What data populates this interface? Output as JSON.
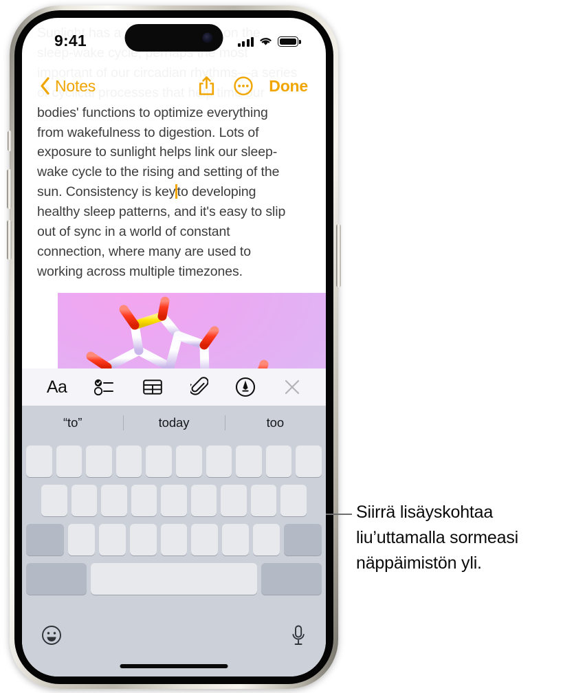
{
  "device": {
    "name": "iphone-15-pro",
    "statusbar": {
      "time": "9:41",
      "cellular_icon": "cellular-signal-icon",
      "wifi_icon": "wifi-icon",
      "battery_icon": "battery-full-icon"
    }
  },
  "navbar": {
    "back_icon": "chevron-left-icon",
    "back_label": "Notes",
    "share_icon": "share-icon",
    "more_icon": "more-circle-icon",
    "done_label": "Done",
    "accent_color": "#f0a500"
  },
  "note": {
    "faded_lines": [
      "Sunlight has a profound impact on the",
      "sleep-wake cycle, perhaps the most",
      "important of our circadian rhythms—a series",
      "of cyclical processes that help time our"
    ],
    "visible_lines": [
      "bodies' functions to optimize everything",
      "from wakefulness to digestion. Lots of",
      "exposure to sunlight helps link our sleep-",
      "wake cycle to the rising and setting of the"
    ],
    "caret_line_before": "sun. Consistency is key",
    "caret_line_after": "to developing",
    "tail_lines": [
      "healthy sleep patterns, and it's easy to slip",
      "out of sync in a world of constant",
      "connection, where many are used to",
      "working across multiple timezones."
    ],
    "attachment": {
      "name": "molecule-image",
      "description": "3D ball-and-stick molecular structure on pink gradient"
    },
    "text_color": "#3c3c3c",
    "caret_color": "#f0a500"
  },
  "format_toolbar": {
    "items": [
      {
        "name": "format-aa-button",
        "label": "Aa",
        "icon": "text-format-icon"
      },
      {
        "name": "checklist-button",
        "label": "",
        "icon": "checklist-icon"
      },
      {
        "name": "table-button",
        "label": "",
        "icon": "table-icon"
      },
      {
        "name": "attachment-button",
        "label": "",
        "icon": "paperclip-icon"
      },
      {
        "name": "markup-button",
        "label": "",
        "icon": "markup-pen-icon"
      },
      {
        "name": "close-keyboard-button",
        "label": "",
        "icon": "close-x-icon"
      }
    ],
    "background": "#f5f4f8"
  },
  "predictive_bar": {
    "suggestions": [
      "“to”",
      "today",
      "too"
    ],
    "background": "#ccd0d9"
  },
  "keyboard": {
    "background": "#ccd0d9",
    "key_color": "#e7e9ed",
    "modifier_color": "#b4bac5",
    "row1_count": 10,
    "row2_count": 9,
    "row3_letter_count": 7,
    "shift_icon": "shift-key",
    "delete_icon": "delete-key",
    "numbers_key": "123-key",
    "space_key": "space-key",
    "return_key": "return-key",
    "emoji_icon": "emoji-smiley-icon",
    "dictation_icon": "microphone-icon"
  },
  "callout": {
    "text": "Siirrä lisäyskohtaa liu’uttamalla sormeasi näppäimistön yli.",
    "line_name": "callout-leader-line"
  }
}
